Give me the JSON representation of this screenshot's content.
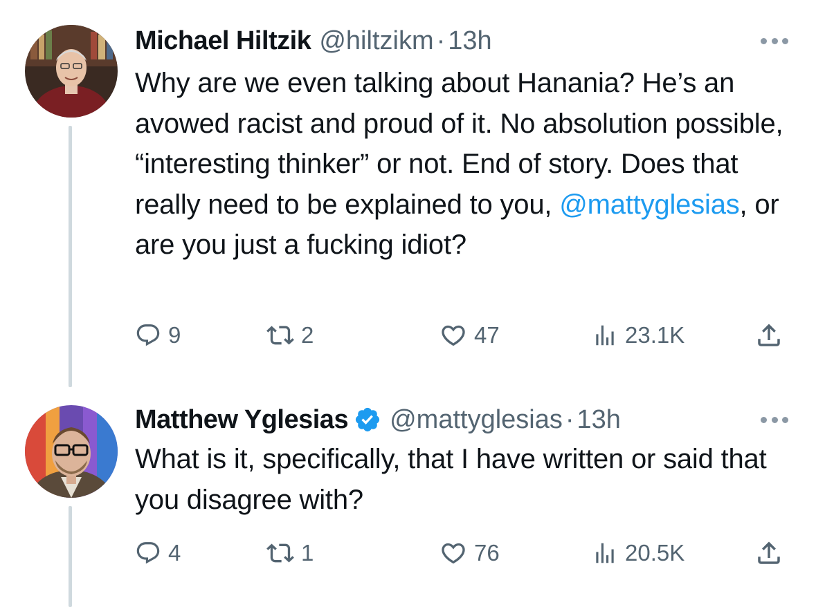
{
  "tweets": [
    {
      "author": {
        "name": "Michael Hiltzik",
        "handle": "@hiltzikm",
        "verified": false,
        "avatar_icon": "avatar-photo"
      },
      "separator": "·",
      "time": "13h",
      "text_parts": [
        "Why are we even talking about Hanania? He’s an avowed racist and proud of it. No absolution possible, “interesting thinker” or not. End of story. Does that really need to be explained to you, ",
        "@mattyglesias",
        ", or are you just a fucking idiot?"
      ],
      "stats": {
        "replies": "9",
        "retweets": "2",
        "likes": "47",
        "views": "23.1K"
      }
    },
    {
      "author": {
        "name": "Matthew Yglesias",
        "handle": "@mattyglesias",
        "verified": true,
        "avatar_icon": "avatar-photo"
      },
      "separator": "·",
      "time": "13h",
      "text_parts": [
        "What is it, specifically, that I have written or said that you disagree with?"
      ],
      "stats": {
        "replies": "4",
        "retweets": "1",
        "likes": "76",
        "views": "20.5K"
      }
    }
  ],
  "colors": {
    "text": "#0f1419",
    "secondary": "#536471",
    "link": "#1d9bf0",
    "thread_line": "#cfd9de",
    "verified": "#1d9bf0"
  },
  "icons": [
    "reply-icon",
    "retweet-icon",
    "like-icon",
    "views-icon",
    "share-icon",
    "more-icon",
    "verified-badge-icon"
  ]
}
